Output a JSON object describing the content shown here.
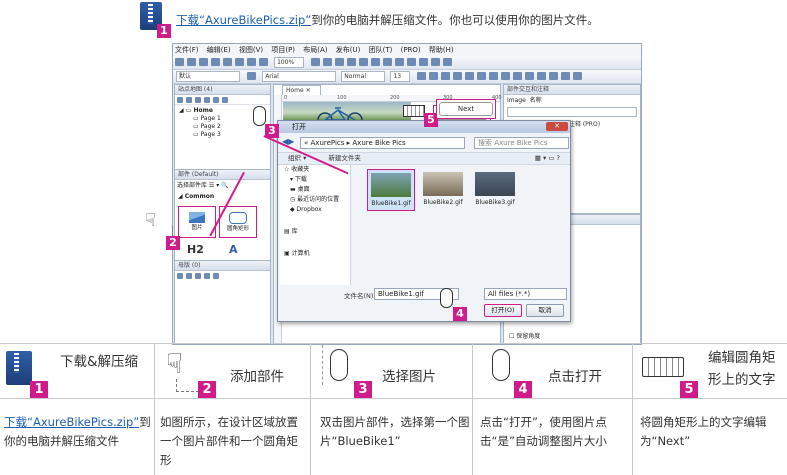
{
  "top": {
    "link_text": "下载“AxureBikePics.zip”",
    "rest_text": "到你的电脑并解压缩文件。你也可以使用你的图片文件。",
    "badge": "1"
  },
  "app": {
    "menu": [
      "文件(F)",
      "编辑(E)",
      "视图(V)",
      "项目(P)",
      "布局(A)",
      "发布(U)",
      "团队(T)",
      "(PRO)",
      "帮助(H)"
    ],
    "zoom": "100%",
    "font_style": "默认",
    "font_name": "Arial",
    "font_weight": "Normal",
    "font_size": "13",
    "sitemap_title": "站点地图 (4)",
    "sitemap_items": [
      "Home",
      "Page 1",
      "Page 2",
      "Page 3"
    ],
    "widgets_title": "部件 (Default)",
    "widgets_filter": "选择部件库",
    "widgets_group": "Common",
    "widget_image_label": "图片",
    "widget_rect_label": "圆角矩形",
    "widget_h2": "H2",
    "widget_a": "A",
    "masters_title": "母版 (0)",
    "canvas_tab": "Home",
    "ruler_labels": [
      "0",
      "100",
      "200",
      "300",
      "400"
    ],
    "next_text": "Next",
    "right_title": "部件交互和注释",
    "image_label": "Image",
    "name_label": "名称",
    "tab_interactions": "交互",
    "tab_notes": "注释 (PRO)",
    "props_title": "部件属性和样式",
    "props_tab": "样式",
    "checkbox_label": "保留角度"
  },
  "dialog": {
    "title": "打开",
    "path": [
      "AxurePics",
      "Axure Bike Pics"
    ],
    "search_placeholder": "搜索 Axure Bike Pics",
    "organize": "组织 ▾",
    "new_folder": "新建文件夹",
    "nav_favorites": "收藏夹",
    "nav_items": [
      "下载",
      "桌面",
      "最近访问的位置",
      "Dropbox"
    ],
    "nav_library": "库",
    "nav_computer": "计算机",
    "files": [
      "BlueBike1.gif",
      "BlueBike2.gif",
      "BlueBike3.gif"
    ],
    "filename_label": "文件名(N):",
    "filename_value": "BlueBike1.gif",
    "filter_value": "All files (*.*)",
    "open_btn": "打开(O)",
    "cancel_btn": "取消"
  },
  "callouts": [
    "2",
    "3",
    "4",
    "5"
  ],
  "steps": [
    {
      "badge": "1",
      "title": "下载&解压缩",
      "desc_link": "下载“AxureBikePics.zip”",
      "desc": "到你的电脑并解压缩文件",
      "icon": "zip-icon"
    },
    {
      "badge": "2",
      "title": "添加部件",
      "desc": "如图所示，在设计区域放置一个图片部件和一个圆角矩形",
      "icon": "drag-hand-icon"
    },
    {
      "badge": "3",
      "title": "选择图片",
      "desc": "双击图片部件，选择第一个图片“BlueBike1”",
      "icon": "mouse-double-click-icon"
    },
    {
      "badge": "4",
      "title": "点击打开",
      "desc": "点击“打开”，使用图片点击“是”自动调整图片大小",
      "icon": "mouse-click-icon"
    },
    {
      "badge": "5",
      "title": "编辑圆角矩形上的文字",
      "desc": "将圆角矩形上的文字编辑为“Next”",
      "icon": "keyboard-icon"
    }
  ],
  "colors": {
    "accent": "#d01c8b",
    "link": "#1e5fb4",
    "brand_blue": "#2f5fa8"
  }
}
